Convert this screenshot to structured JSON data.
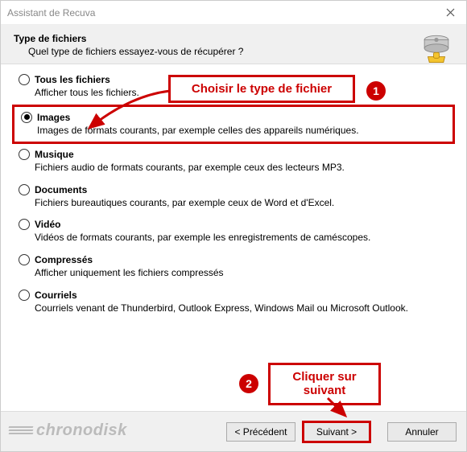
{
  "window": {
    "title": "Assistant de Recuva"
  },
  "header": {
    "heading": "Type de fichiers",
    "sub": "Quel type de fichiers essayez-vous de récupérer ?"
  },
  "options": [
    {
      "label": "Tous les fichiers",
      "desc": "Afficher tous les fichiers.",
      "checked": false
    },
    {
      "label": "Images",
      "desc": "Images de formats courants, par exemple celles des appareils numériques.",
      "checked": true
    },
    {
      "label": "Musique",
      "desc": "Fichiers audio de formats courants, par exemple ceux des lecteurs MP3.",
      "checked": false
    },
    {
      "label": "Documents",
      "desc": "Fichiers bureautiques courants, par exemple ceux de Word et d'Excel.",
      "checked": false
    },
    {
      "label": "Vidéo",
      "desc": "Vidéos de formats courants, par exemple les enregistrements de caméscopes.",
      "checked": false
    },
    {
      "label": "Compressés",
      "desc": "Afficher uniquement les fichiers compressés",
      "checked": false
    },
    {
      "label": "Courriels",
      "desc": "Courriels venant de Thunderbird, Outlook Express, Windows Mail ou Microsoft Outlook.",
      "checked": false
    }
  ],
  "buttons": {
    "back": "< Précédent",
    "next": "Suivant >",
    "cancel": "Annuler"
  },
  "annotations": {
    "callout1": "Choisir le type de fichier",
    "callout2": "Cliquer sur\nsuivant",
    "marker1": "1",
    "marker2": "2"
  },
  "watermark": "chronodisk"
}
